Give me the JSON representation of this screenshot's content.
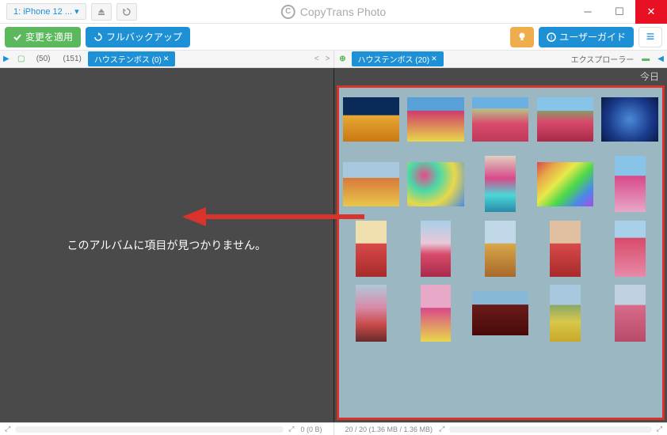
{
  "titlebar": {
    "device_dropdown": "1: iPhone 12 ...",
    "app_name": "CopyTrans Photo"
  },
  "toolbar": {
    "apply_label": "変更を適用",
    "backup_label": "フルバックアップ",
    "guide_label": "ユーザーガイド"
  },
  "crumbs": {
    "left": {
      "count1": "(50)",
      "count2": "(151)",
      "album": "ハウステンボス (0)"
    },
    "right": {
      "album": "ハウステンボス (20)",
      "explorer": "エクスプローラー"
    }
  },
  "panes": {
    "left_empty": "このアルバムに項目が見つかりません。",
    "right_date": "今日"
  },
  "thumbs": {
    "orientations": [
      "l",
      "l",
      "l",
      "l",
      "l",
      "l",
      "l",
      "p",
      "l",
      "p",
      "p",
      "p",
      "p",
      "p",
      "p",
      "p",
      "p",
      "l",
      "p",
      "p"
    ]
  },
  "status": {
    "left": "0 (0 B)",
    "right": "20 / 20 (1.36 MB / 1.36 MB)"
  }
}
